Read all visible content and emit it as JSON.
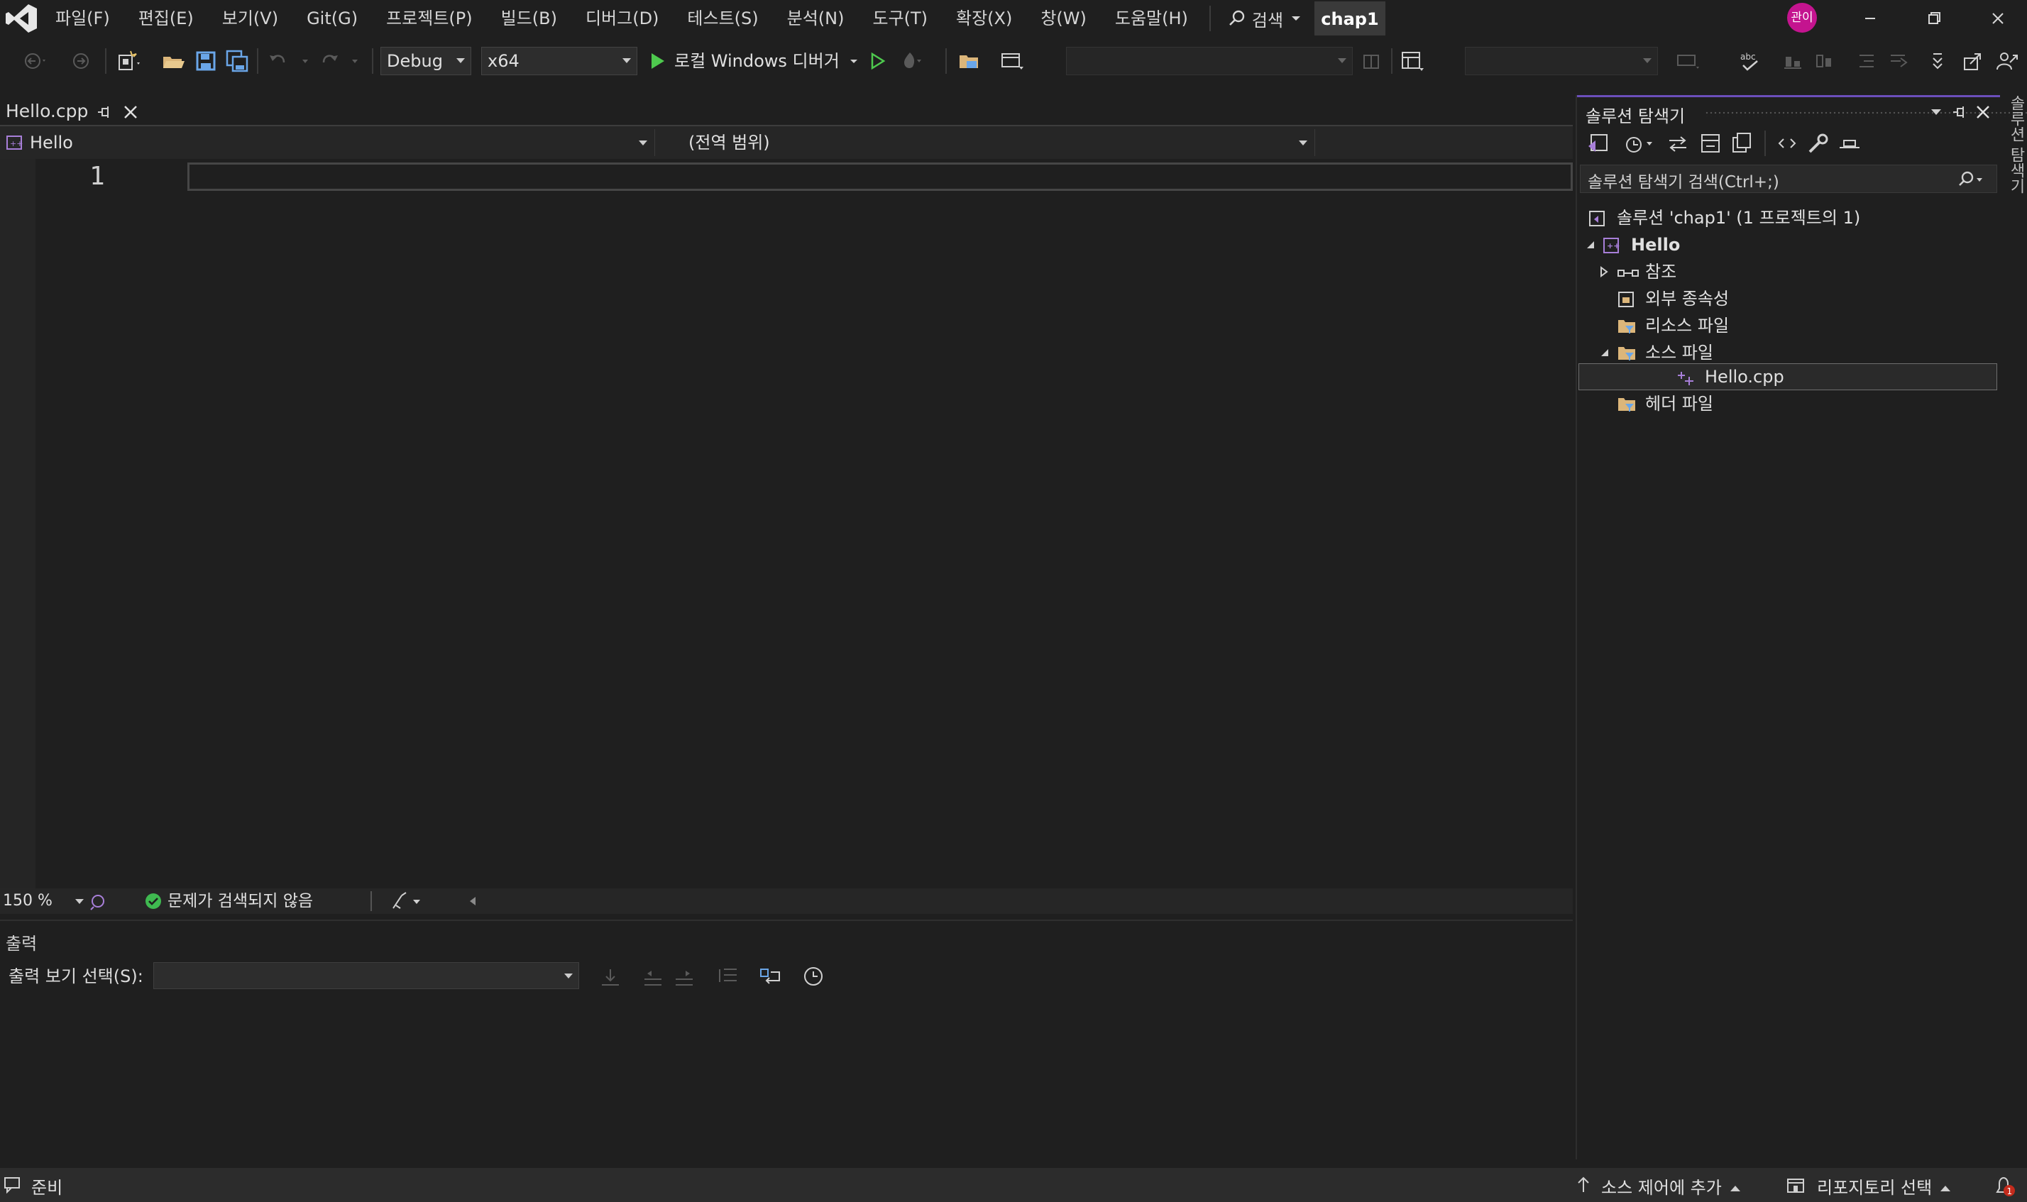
{
  "menu": {
    "items": [
      "파일(F)",
      "편집(E)",
      "보기(V)",
      "Git(G)",
      "프로젝트(P)",
      "빌드(B)",
      "디버그(D)",
      "테스트(S)",
      "분석(N)",
      "도구(T)",
      "확장(X)",
      "창(W)",
      "도움말(H)"
    ],
    "search_label": "검색",
    "project_title": "chap1",
    "avatar_initials": "관이"
  },
  "toolbar": {
    "configuration": "Debug",
    "platform": "x64",
    "run_label": "로컬 Windows 디버거"
  },
  "editor": {
    "tab_title": "Hello.cpp",
    "nav_project": "Hello",
    "nav_scope": "(전역 범위)",
    "line_number": "1",
    "zoom": "150 %",
    "issues": "문제가 검색되지 않음"
  },
  "output": {
    "title": "출력",
    "select_label": "출력 보기 선택(S):",
    "selected_value": ""
  },
  "solution_explorer": {
    "title": "솔루션 탐색기",
    "search_placeholder": "솔루션 탐색기 검색(Ctrl+;)",
    "side_tab": "솔루션 탐색기",
    "tree": {
      "solution": "솔루션 'chap1' (1 프로젝트의 1)",
      "project": "Hello",
      "references": "참조",
      "external_deps": "외부 종속성",
      "resource_files": "리소스 파일",
      "source_files": "소스 파일",
      "source_file_item": "Hello.cpp",
      "header_files": "헤더 파일"
    }
  },
  "statusbar": {
    "ready": "준비",
    "source_control": "소스 제어에 추가",
    "repository": "리포지토리 선택",
    "notification_count": "1"
  },
  "colors": {
    "background": "#1f1f1f",
    "accent": "#6b4fbb",
    "run_green": "#4ec94e",
    "folder": "#dcb67a",
    "project_purple": "#a87fd9",
    "avatar": "#c4148f"
  }
}
